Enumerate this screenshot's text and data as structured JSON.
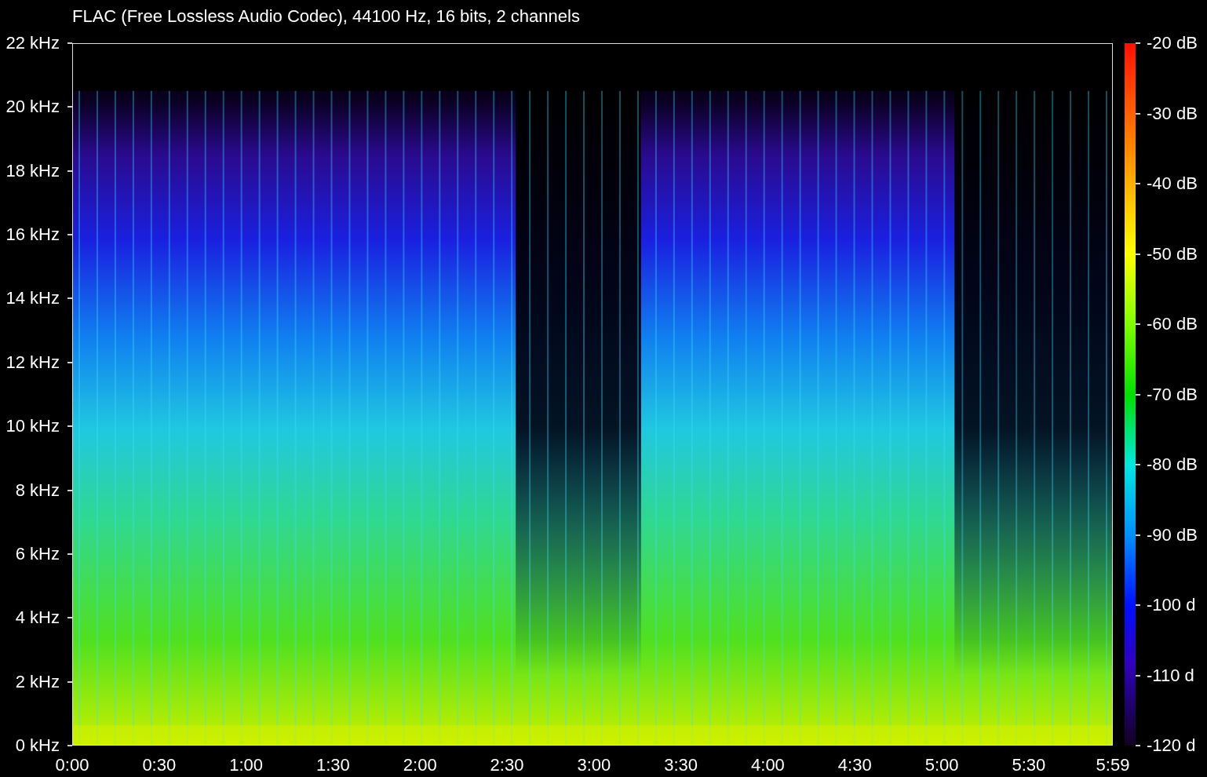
{
  "title": "FLAC (Free Lossless Audio Codec), 44100 Hz, 16 bits, 2 channels",
  "frequency_axis": {
    "labels": [
      "22 kHz",
      "20 kHz",
      "18 kHz",
      "16 kHz",
      "14 kHz",
      "12 kHz",
      "10 kHz",
      "8 kHz",
      "6 kHz",
      "4 kHz",
      "2 kHz",
      "0 kHz"
    ]
  },
  "time_axis": {
    "labels": [
      "0:00",
      "0:30",
      "1:00",
      "1:30",
      "2:00",
      "2:30",
      "3:00",
      "3:30",
      "4:00",
      "4:30",
      "5:00",
      "5:30",
      "5:59"
    ]
  },
  "level_scale": {
    "labels": [
      "-20 dB",
      "-30 dB",
      "-40 dB",
      "-50 dB",
      "-60 dB",
      "-70 dB",
      "-80 dB",
      "-90 dB",
      "-100 d",
      "-110 d",
      "-120 d"
    ]
  }
}
